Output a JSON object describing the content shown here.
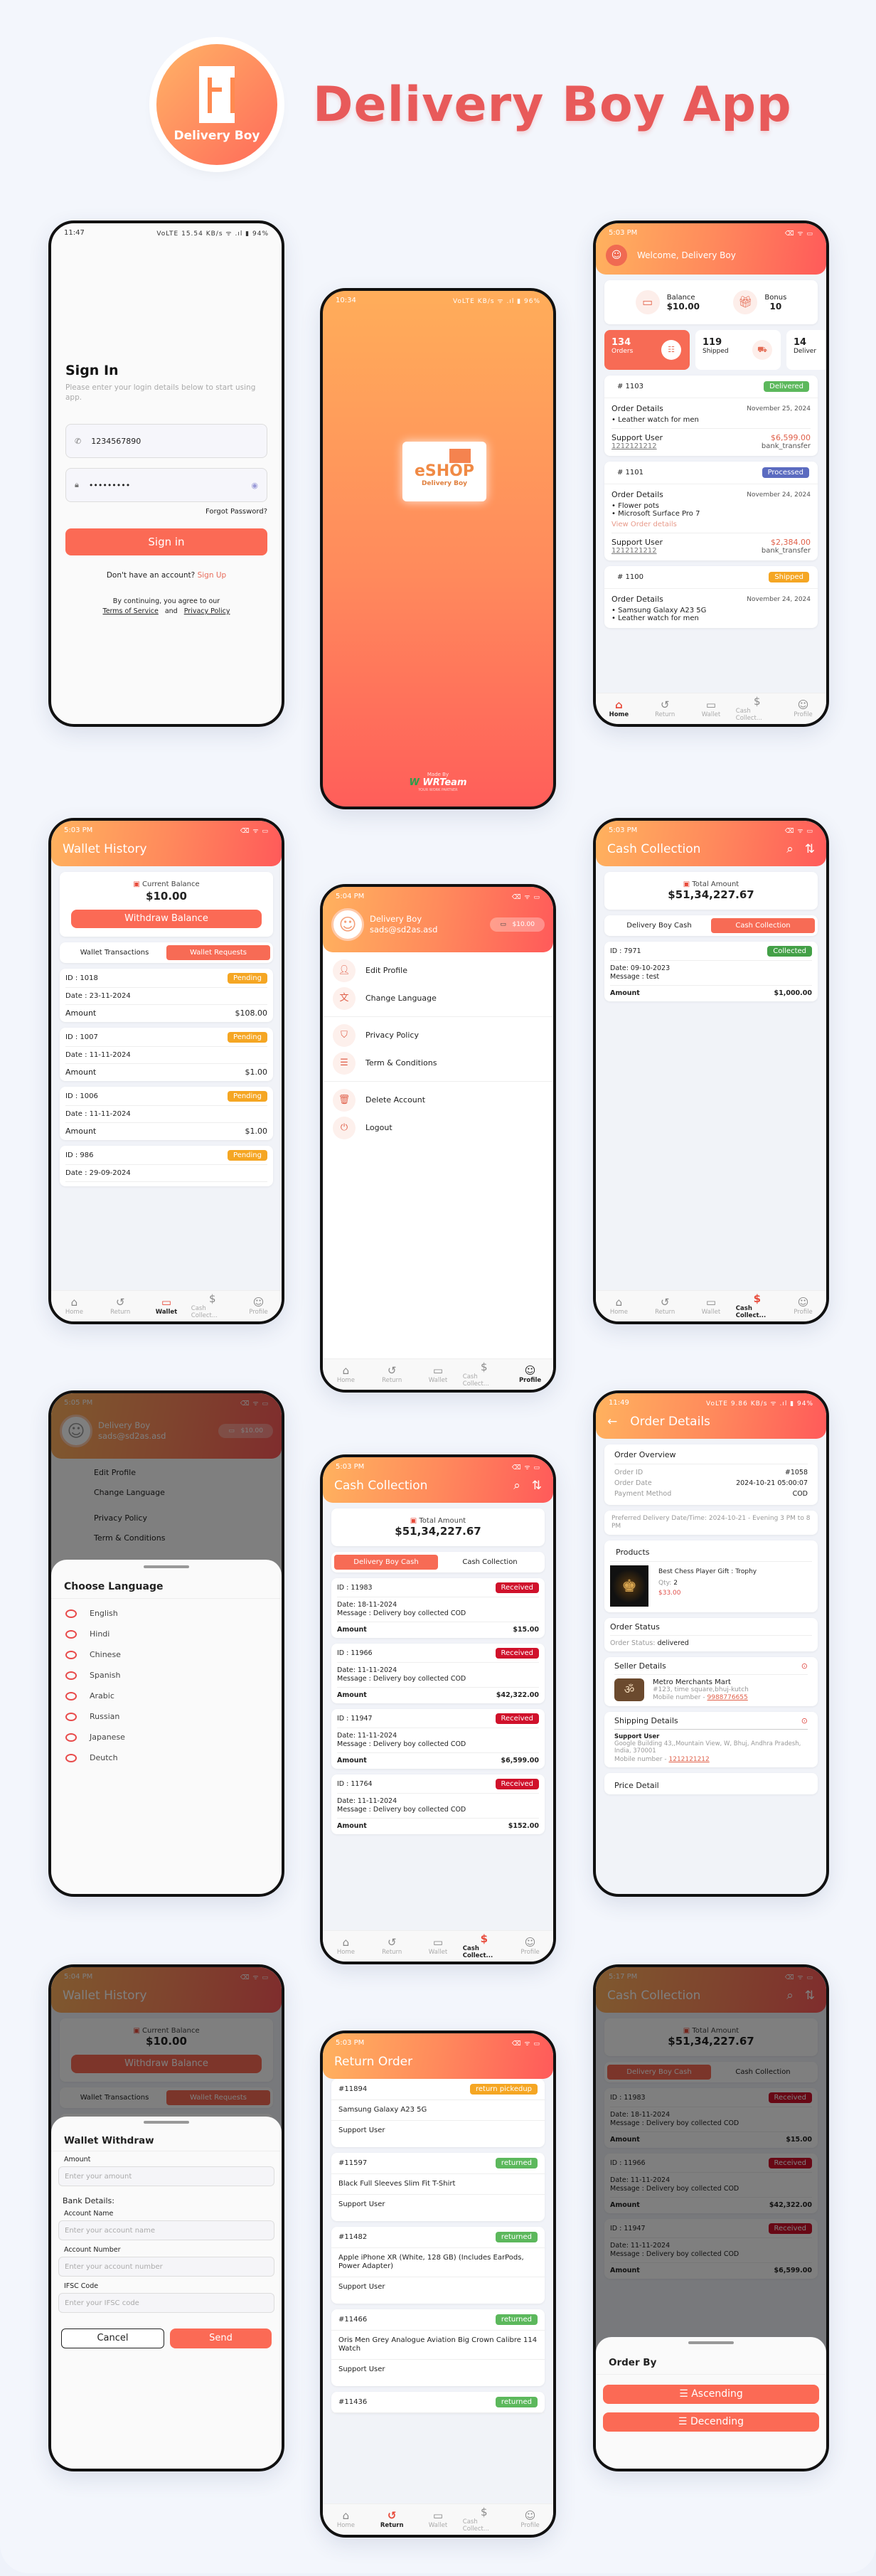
{
  "hero": {
    "logo_text": "Delivery Boy",
    "title": "Delivery Boy App"
  },
  "colors": {
    "accent": "#fb6a55",
    "title_red": "#e85a5a",
    "delivered": "#5cb85c",
    "processed": "#5b6bc0",
    "shipped": "#f5a623",
    "pending": "#f5a623",
    "received": "#d0112b",
    "collected": "#43a047",
    "returned": "#5cb85c",
    "link_red": "#e86b5a"
  },
  "nav": {
    "home": "Home",
    "return": "Return",
    "wallet": "Wallet",
    "cash": "Cash Collect...",
    "profile": "Profile"
  },
  "signin": {
    "time": "11:47",
    "status_icons": "VoLTE 15.54 KB/s ᯤ .ıl ▮ 94%",
    "title": "Sign In",
    "subtitle": "Please enter your login details below to start using app.",
    "phone_value": "1234567890",
    "password_value": "•••••••••",
    "forgot": "Forgot Password?",
    "button": "Sign in",
    "no_account": "Don't have an account?",
    "signup": "Sign Up",
    "agree": "By continuing, you agree to our",
    "terms": "Terms of Service",
    "and": "and",
    "privacy": "Privacy Policy"
  },
  "splash": {
    "time": "10:34",
    "status_icons": "VoLTE KB/s ᯤ .ıl ▮ 96%",
    "brand": "eSHOP",
    "sub": "Delivery Boy",
    "made_by": "Made By",
    "company": "WRTeam",
    "tagline": "YOUR WORK PARTNER"
  },
  "home": {
    "time": "5:03 PM",
    "welcome": "Welcome, Delivery Boy",
    "balance_label": "Balance",
    "balance_value": "$10.00",
    "bonus_label": "Bonus",
    "bonus_value": "10",
    "stats": [
      {
        "value": "134",
        "label": "Orders"
      },
      {
        "value": "119",
        "label": "Shipped"
      },
      {
        "value": "14",
        "label": "Deliver"
      }
    ],
    "orders": [
      {
        "id": "# 1103",
        "status": "Delivered",
        "details_label": "Order Details",
        "date": "November 25, 2024",
        "items": [
          "Leather watch for men"
        ],
        "link": "",
        "user": "Support User",
        "phone": "1212121212",
        "amount": "$6,599.00",
        "method": "bank_transfer"
      },
      {
        "id": "# 1101",
        "status": "Processed",
        "details_label": "Order Details",
        "date": "November 24, 2024",
        "items": [
          "Flower pots",
          "Microsoft Surface Pro 7"
        ],
        "link": "View Order details",
        "user": "Support User",
        "phone": "1212121212",
        "amount": "$2,384.00",
        "method": "bank_transfer"
      },
      {
        "id": "# 1100",
        "status": "Shipped",
        "details_label": "Order Details",
        "date": "November 24, 2024",
        "items": [
          "Samsung Galaxy A23 5G",
          "Leather watch for men"
        ]
      }
    ]
  },
  "wallet": {
    "time": "5:03 PM",
    "title": "Wallet History",
    "balance_label": "Current Balance",
    "balance_value": "$10.00",
    "withdraw": "Withdraw Balance",
    "tab_transactions": "Wallet Transactions",
    "tab_requests": "Wallet Requests",
    "amount_label": "Amount",
    "requests": [
      {
        "id": "ID : 1018",
        "status": "Pending",
        "date": "Date : 23-11-2024",
        "amount": "$108.00"
      },
      {
        "id": "ID : 1007",
        "status": "Pending",
        "date": "Date : 11-11-2024",
        "amount": "$1.00"
      },
      {
        "id": "ID : 1006",
        "status": "Pending",
        "date": "Date : 11-11-2024",
        "amount": "$1.00"
      },
      {
        "id": "ID : 986",
        "status": "Pending",
        "date": "Date : 29-09-2024",
        "amount": ""
      }
    ]
  },
  "profile": {
    "time": "5:04 PM",
    "name": "Delivery Boy",
    "email": "sads@sd2as.asd",
    "wallet": "$10.00",
    "menu": [
      "Edit Profile",
      "Change Language",
      "Privacy Policy",
      "Term & Conditions",
      "Delete Account",
      "Logout"
    ]
  },
  "cash1": {
    "time": "5:03 PM",
    "title": "Cash Collection",
    "total_label": "Total Amount",
    "total_value": "$51,34,227.67",
    "tab_boy": "Delivery Boy Cash",
    "tab_collection": "Cash Collection",
    "item": {
      "id": "ID : 7971",
      "status": "Collected",
      "date": "Date: 09-10-2023",
      "message": "Message : test",
      "amount_label": "Amount",
      "amount": "$1,000.00"
    }
  },
  "language": {
    "time": "5:05 PM",
    "title": "Choose Language",
    "options": [
      "English",
      "Hindi",
      "Chinese",
      "Spanish",
      "Arabic",
      "Russian",
      "Japanese",
      "Deutch"
    ]
  },
  "cash2": {
    "time": "5:03 PM",
    "amount_label": "Amount",
    "items": [
      {
        "id": "ID : 11983",
        "status": "Received",
        "date": "Date: 18-11-2024",
        "message": "Message : Delivery boy collected COD",
        "amount": "$15.00"
      },
      {
        "id": "ID : 11966",
        "status": "Received",
        "date": "Date: 11-11-2024",
        "message": "Message : Delivery boy collected COD",
        "amount": "$42,322.00"
      },
      {
        "id": "ID : 11947",
        "status": "Received",
        "date": "Date: 11-11-2024",
        "message": "Message : Delivery boy collected COD",
        "amount": "$6,599.00"
      },
      {
        "id": "ID : 11764",
        "status": "Received",
        "date": "Date: 11-11-2024",
        "message": "Message : Delivery boy collected COD",
        "amount": "$152.00"
      }
    ]
  },
  "order_details": {
    "time": "11:49",
    "status_icons": "VoLTE 9.86 KB/s ᯤ .ıl ▮ 94%",
    "title": "Order Details",
    "overview_title": "Order Overview",
    "rows": [
      {
        "label": "Order ID",
        "value": "#1058"
      },
      {
        "label": "Order Date",
        "value": "2024-10-21 05:00:07"
      },
      {
        "label": "Payment Method",
        "value": "COD"
      }
    ],
    "preferred": "Preferred Delivery Date/Time: 2024-10-21 - Evening 3 PM to 8 PM",
    "products_title": "Products",
    "product_name": "Best Chess Player Gift : Trophy",
    "qty_label": "Qty:",
    "qty": "2",
    "price": "$33.00",
    "status_title": "Order Status",
    "status_label": "Order Status:",
    "status_value": "delivered",
    "seller_title": "Seller Details",
    "seller_name": "Metro Merchants Mart",
    "seller_address": "#123, time square,bhuj-kutch",
    "mobile_label": "Mobile number -",
    "seller_mobile": "9988776655",
    "shipping_title": "Shipping Details",
    "ship_name": "Support User",
    "ship_address": "Google Building 43,,Mountain View, W, Bhuj, Andhra Pradesh, India, 370001",
    "ship_mobile": "1212121212",
    "price_title": "Price Detail"
  },
  "withdraw": {
    "time": "5:04 PM",
    "title": "Wallet Withdraw",
    "amount_label": "Amount",
    "amount_placeholder": "Enter your amount",
    "bank_label": "Bank Details:",
    "acc_name_label": "Account Name",
    "acc_name_placeholder": "Enter your account name",
    "acc_num_label": "Account Number",
    "acc_num_placeholder": "Enter your account number",
    "ifsc_label": "IFSC Code",
    "ifsc_placeholder": "Enter your IFSC code",
    "cancel": "Cancel",
    "send": "Send",
    "bg_id": "ID : 1018",
    "bg_status": "Pending"
  },
  "returns": {
    "time": "5:03 PM",
    "title": "Return Order",
    "items": [
      {
        "id": "#11894",
        "status": "return pickedup",
        "product": "Samsung Galaxy A23 5G",
        "user": "Support User"
      },
      {
        "id": "#11597",
        "status": "returned",
        "product": "Black Full Sleeves Slim Fit T-Shirt",
        "user": "Support User"
      },
      {
        "id": "#11482",
        "status": "returned",
        "product": "Apple iPhone XR (White, 128 GB) (Includes EarPods, Power Adapter)",
        "user": "Support User"
      },
      {
        "id": "#11466",
        "status": "returned",
        "product": "Oris Men Grey Analogue Aviation Big Crown Calibre 114 Watch",
        "user": "Support User"
      },
      {
        "id": "#11436",
        "status": "returned",
        "product": "",
        "user": ""
      }
    ]
  },
  "orderby": {
    "time": "5:17 PM",
    "title": "Order By",
    "asc": "Ascending",
    "desc": "Decending"
  }
}
